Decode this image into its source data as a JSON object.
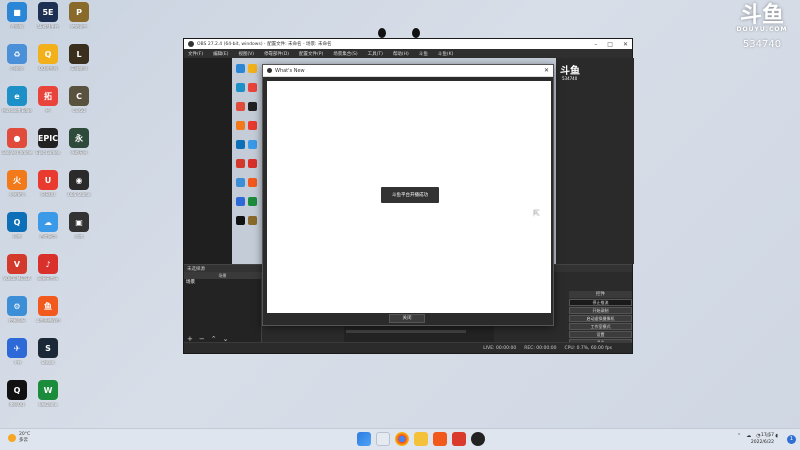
{
  "watermark": {
    "logo": "斗鱼",
    "brand": "DOUYU.COM",
    "room_id": "534740"
  },
  "desktop_icons": [
    {
      "label": "此电脑",
      "color": "#2b87d6",
      "glyph": "■"
    },
    {
      "label": "回收站",
      "color": "#4a90d9",
      "glyph": "♻"
    },
    {
      "label": "Microsoft Edge",
      "color": "#1e90c8",
      "glyph": "e"
    },
    {
      "label": "Google Chrome",
      "color": "#e14b3b",
      "glyph": "●"
    },
    {
      "label": "火绒安全",
      "color": "#f27a1a",
      "glyph": "火"
    },
    {
      "label": "迅雷",
      "color": "#0c6fb8",
      "glyph": "Q"
    },
    {
      "label": "VOICE METER",
      "color": "#d33a2c",
      "glyph": "V"
    },
    {
      "label": "控制面板",
      "color": "#3c8fd6",
      "glyph": "⚙"
    },
    {
      "label": "飞书",
      "color": "#2d6ad8",
      "glyph": "✈"
    },
    {
      "label": "腾讯QQ",
      "color": "#111111",
      "glyph": "Q"
    },
    {
      "label": "5E对战平台",
      "color": "#1d2f52",
      "glyph": "5E"
    },
    {
      "label": "QQ浏览器",
      "color": "#f2b01b",
      "glyph": "Q"
    },
    {
      "label": "拓",
      "color": "#e9443c",
      "glyph": "拓"
    },
    {
      "label": "Epic Games",
      "color": "#222222",
      "glyph": "EPIC"
    },
    {
      "label": "网易UU",
      "color": "#e83a2f",
      "glyph": "U"
    },
    {
      "label": "百度网盘",
      "color": "#3a9ae8",
      "glyph": "☁"
    },
    {
      "label": "网易云音乐",
      "color": "#d9302c",
      "glyph": "♪"
    },
    {
      "label": "斗鱼直播伴侣",
      "color": "#f25a1d",
      "glyph": "鱼"
    },
    {
      "label": "Steam",
      "color": "#1b2838",
      "glyph": "S"
    },
    {
      "label": "WeGame",
      "color": "#1a8c3c",
      "glyph": "W"
    },
    {
      "label": "绝地求生",
      "color": "#8a6a2a",
      "glyph": "P"
    },
    {
      "label": "英雄联盟",
      "color": "#3a2f1c",
      "glyph": "L"
    },
    {
      "label": "CS:GO",
      "color": "#58523e",
      "glyph": "C"
    },
    {
      "label": "永劫无间",
      "color": "#2e4a3a",
      "glyph": "永"
    },
    {
      "label": "OBS Studio",
      "color": "#2a2a2a",
      "glyph": "◉"
    },
    {
      "label": "游戏",
      "color": "#333333",
      "glyph": "▣"
    }
  ],
  "obs": {
    "title": "OBS 27.2.4 (64-bit, windows) - 配置文件: 未命名 - 场景: 未命名",
    "menu": [
      "文件(F)",
      "编辑(E)",
      "视图(V)",
      "停靠部件(D)",
      "配置文件(P)",
      "场景集合(S)",
      "工具(T)",
      "帮助(H)",
      "斗鱼",
      "斗鱼(K)"
    ],
    "scenes_header": "场景",
    "scene_item": "场景",
    "scene_dock_label": "未选择源",
    "controls_header": "控件",
    "controls": [
      "停止推流",
      "开始录制",
      "启动虚拟摄像机",
      "工作室模式",
      "设置",
      "退出"
    ],
    "status": [
      "LIVE: 00:00:00",
      "REC: 00:00:00",
      "CPU: 0.7%, 60.00 fps"
    ],
    "preview_watermark": "斗鱼",
    "preview_id": "534740"
  },
  "dialog": {
    "title": "What's New",
    "toast": "斗鱼平台开播成功",
    "close_label": "关闭"
  },
  "taskbar": {
    "temperature": "20°C",
    "weather_text": "多云",
    "time": "17:57",
    "date": "2022/6/22",
    "notification_count": "1"
  }
}
